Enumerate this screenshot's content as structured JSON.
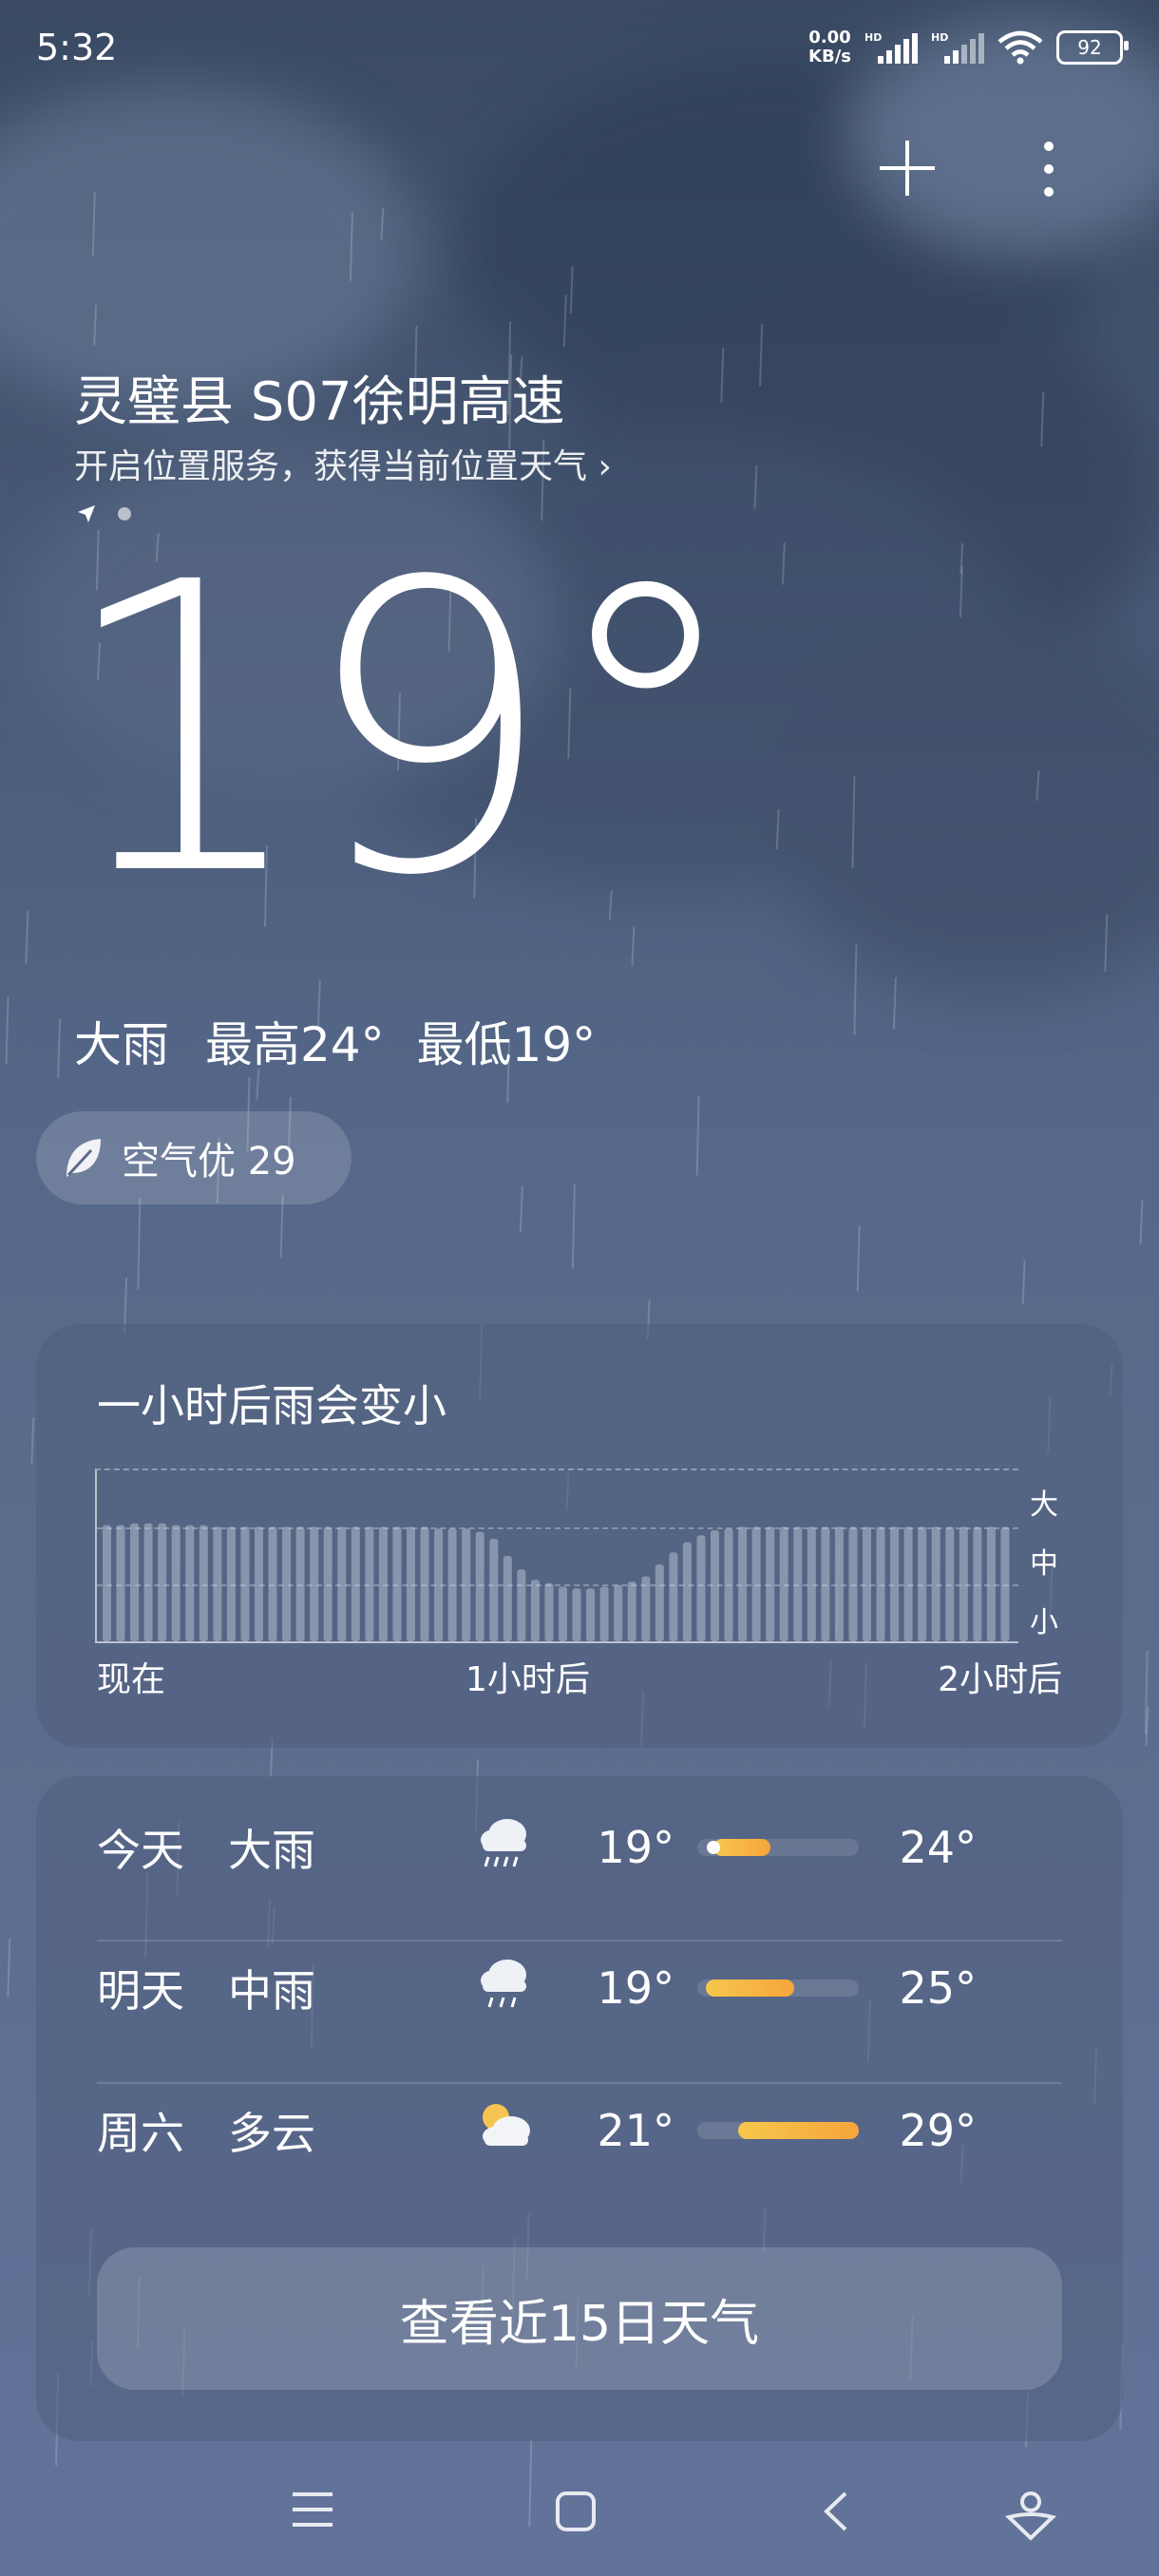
{
  "status": {
    "time": "5:32",
    "speed_value": "0.00",
    "speed_unit": "KB/s",
    "battery": "92"
  },
  "location": {
    "name": "灵璧县 S07徐明高速",
    "hint": "开启位置服务，获得当前位置天气"
  },
  "current": {
    "temp": "19°",
    "condition": "大雨",
    "high": "最高24°",
    "low": "最低19°"
  },
  "aqi": {
    "label": "空气优 29"
  },
  "rain_card": {
    "title": "一小时后雨会变小",
    "levels": [
      "大",
      "中",
      "小"
    ],
    "x_labels": [
      "现在",
      "1小时后",
      "2小时后"
    ],
    "intensity": [
      0.68,
      0.68,
      0.69,
      0.69,
      0.69,
      0.68,
      0.68,
      0.68,
      0.67,
      0.67,
      0.67,
      0.67,
      0.67,
      0.67,
      0.67,
      0.67,
      0.67,
      0.67,
      0.67,
      0.67,
      0.67,
      0.67,
      0.67,
      0.67,
      0.66,
      0.66,
      0.66,
      0.64,
      0.6,
      0.5,
      0.42,
      0.36,
      0.34,
      0.32,
      0.31,
      0.31,
      0.32,
      0.33,
      0.35,
      0.38,
      0.45,
      0.52,
      0.58,
      0.62,
      0.65,
      0.66,
      0.67,
      0.67,
      0.67,
      0.67,
      0.67,
      0.67,
      0.67,
      0.67,
      0.67,
      0.67,
      0.67,
      0.67,
      0.67,
      0.67,
      0.67,
      0.67,
      0.67,
      0.67,
      0.67,
      0.67
    ]
  },
  "forecast": [
    {
      "day": "今天",
      "desc": "大雨",
      "icon": "heavy-rain-icon",
      "low": "19°",
      "high": "24°",
      "bar_start": 0.1,
      "bar_end": 0.45
    },
    {
      "day": "明天",
      "desc": "中雨",
      "icon": "moderate-rain-icon",
      "low": "19°",
      "high": "25°",
      "bar_start": 0.05,
      "bar_end": 0.6
    },
    {
      "day": "周六",
      "desc": "多云",
      "icon": "partly-cloudy-icon",
      "low": "21°",
      "high": "29°",
      "bar_start": 0.25,
      "bar_end": 1.0
    }
  ],
  "forecast_button": "查看近15日天气",
  "colors": {
    "temp_bar_start": "#f7c74d",
    "temp_bar_end": "#f5a53b",
    "background_top": "#3a4a63",
    "background_bottom": "#62739a"
  }
}
